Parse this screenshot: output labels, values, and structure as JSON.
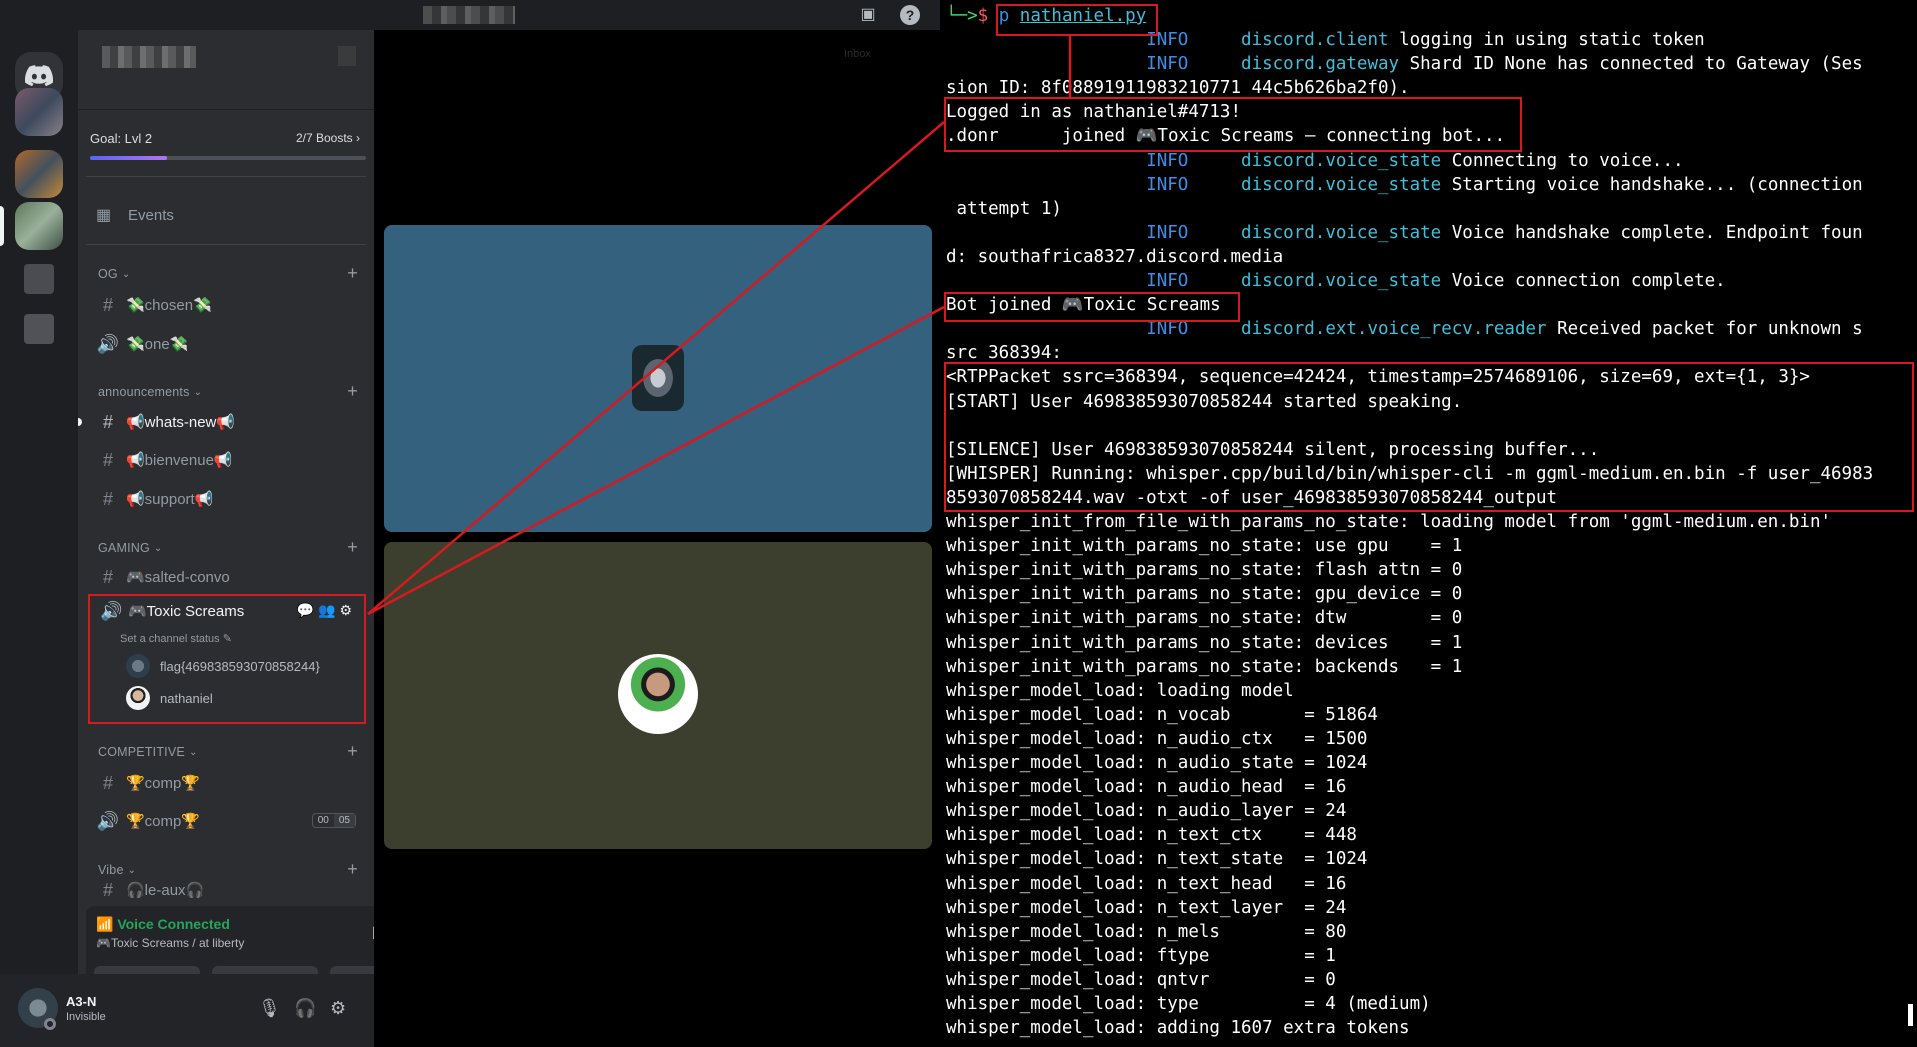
{
  "colors": {
    "annotation": "#d71920",
    "discord_bg": "#1e1f22",
    "terminal_bg": "#000000",
    "voice_green": "#23a55a",
    "info_blue": "#3b8eea",
    "logger_cyan": "#3fbfd8"
  },
  "discord": {
    "server": {
      "goal": "Goal: Lvl 2",
      "boosts": "2/7 Boosts",
      "boost_progress": 0.28
    },
    "events_label": "Events",
    "categories": [
      {
        "name": "OG",
        "channels": [
          {
            "type": "text",
            "name": "💸chosen💸"
          },
          {
            "type": "voice",
            "name": "💸one💸"
          }
        ]
      },
      {
        "name": "announcements",
        "channels": [
          {
            "type": "text",
            "name": "📢whats-new📢"
          },
          {
            "type": "text",
            "name": "📢bienvenue📢"
          },
          {
            "type": "text",
            "name": "📢support📢"
          }
        ]
      },
      {
        "name": "GAMING",
        "channels": [
          {
            "type": "text",
            "name": "🎮salted-convo"
          }
        ]
      },
      {
        "name": "COMPETITIVE",
        "channels": [
          {
            "type": "text",
            "name": "🏆comp🏆"
          },
          {
            "type": "voice",
            "name": "🏆comp🏆",
            "badge": [
              "00",
              "05"
            ]
          }
        ]
      },
      {
        "name": "Vibe",
        "channels": [
          {
            "type": "text",
            "name": "🎧le-aux🎧"
          }
        ]
      }
    ],
    "active_voice": {
      "name": "🎮Toxic Screams",
      "status": "Set a channel status",
      "users": [
        {
          "name": "flag{469838593070858244}",
          "avatar": "bot"
        },
        {
          "name": "nathaniel",
          "avatar": "person"
        }
      ]
    },
    "voice_panel": {
      "state": "Voice Connected",
      "location": "🎮Toxic Screams / at liberty"
    },
    "user": {
      "name": "A3-N",
      "status": "Invisible"
    },
    "inbox_label": "Inbox"
  },
  "terminal": {
    "prompt_arrow": "└─>",
    "prompt_symbol": "$",
    "command_prefix": "p",
    "command_file": "nathaniel.py",
    "lines": [
      {
        "level": "INFO",
        "logger": "discord.client",
        "msg": "logging in using static token"
      },
      {
        "level": "INFO",
        "logger": "discord.gateway",
        "msg": "Shard ID None has connected to Gateway (Ses"
      },
      {
        "plain": "sion ID: 8f08891911983210771 44c5b626ba2f0)."
      },
      {
        "plain": "Logged in as nathaniel#4713!"
      },
      {
        "plain": ".donr      joined 🎮Toxic Screams — connecting bot..."
      },
      {
        "level": "INFO",
        "logger": "discord.voice_state",
        "msg": "Connecting to voice..."
      },
      {
        "level": "INFO",
        "logger": "discord.voice_state",
        "msg": "Starting voice handshake... (connection"
      },
      {
        "plain": " attempt 1)"
      },
      {
        "level": "INFO",
        "logger": "discord.voice_state",
        "msg": "Voice handshake complete. Endpoint foun"
      },
      {
        "plain": "d: southafrica8327.discord.media"
      },
      {
        "level": "INFO",
        "logger": "discord.voice_state",
        "msg": "Voice connection complete."
      },
      {
        "plain": "Bot joined 🎮Toxic Screams"
      },
      {
        "level": "INFO",
        "logger": "discord.ext.voice_recv.reader",
        "msg": "Received packet for unknown s"
      },
      {
        "plain": "src 368394:"
      },
      {
        "plain": "<RTPPacket ssrc=368394, sequence=42424, timestamp=2574689106, size=69, ext={1, 3}>"
      },
      {
        "plain": "[START] User 469838593070858244 started speaking."
      },
      {
        "plain": ""
      },
      {
        "plain": "[SILENCE] User 469838593070858244 silent, processing buffer..."
      },
      {
        "plain": "[WHISPER] Running: whisper.cpp/build/bin/whisper-cli -m ggml-medium.en.bin -f user_46983"
      },
      {
        "plain": "8593070858244.wav -otxt -of user_469838593070858244_output"
      },
      {
        "plain": "whisper_init_from_file_with_params_no_state: loading model from 'ggml-medium.en.bin'"
      },
      {
        "plain": "whisper_init_with_params_no_state: use gpu    = 1"
      },
      {
        "plain": "whisper_init_with_params_no_state: flash attn = 0"
      },
      {
        "plain": "whisper_init_with_params_no_state: gpu_device = 0"
      },
      {
        "plain": "whisper_init_with_params_no_state: dtw        = 0"
      },
      {
        "plain": "whisper_init_with_params_no_state: devices    = 1"
      },
      {
        "plain": "whisper_init_with_params_no_state: backends   = 1"
      },
      {
        "plain": "whisper_model_load: loading model"
      },
      {
        "plain": "whisper_model_load: n_vocab       = 51864"
      },
      {
        "plain": "whisper_model_load: n_audio_ctx   = 1500"
      },
      {
        "plain": "whisper_model_load: n_audio_state = 1024"
      },
      {
        "plain": "whisper_model_load: n_audio_head  = 16"
      },
      {
        "plain": "whisper_model_load: n_audio_layer = 24"
      },
      {
        "plain": "whisper_model_load: n_text_ctx    = 448"
      },
      {
        "plain": "whisper_model_load: n_text_state  = 1024"
      },
      {
        "plain": "whisper_model_load: n_text_head   = 16"
      },
      {
        "plain": "whisper_model_load: n_text_layer  = 24"
      },
      {
        "plain": "whisper_model_load: n_mels        = 80"
      },
      {
        "plain": "whisper_model_load: ftype         = 1"
      },
      {
        "plain": "whisper_model_load: qntvr         = 0"
      },
      {
        "plain": "whisper_model_load: type          = 4 (medium)"
      },
      {
        "plain": "whisper_model_load: adding 1607 extra tokens"
      }
    ]
  }
}
